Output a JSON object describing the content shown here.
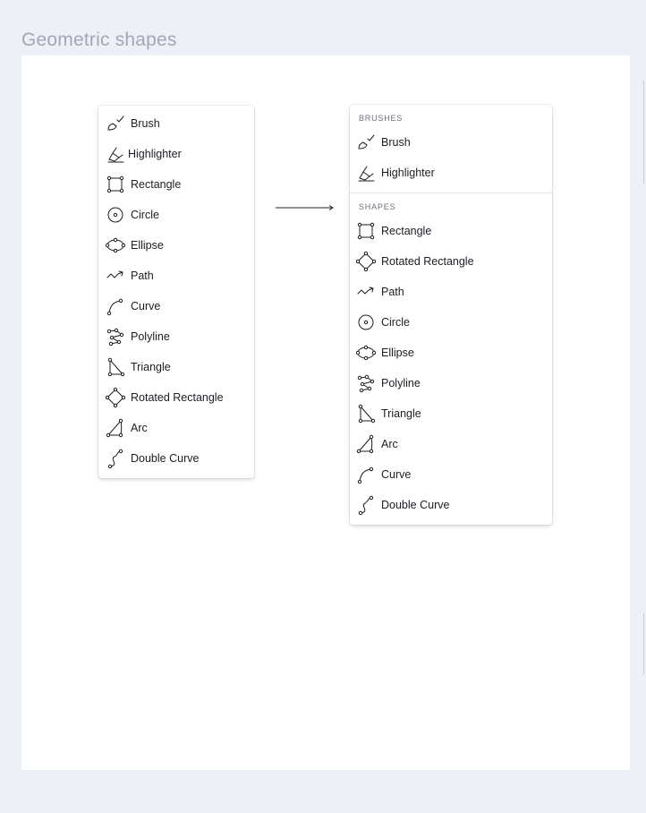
{
  "page": {
    "title": "Geometric shapes"
  },
  "left_menu": {
    "items": [
      {
        "label": "Brush",
        "icon": "brush-icon"
      },
      {
        "label": "Highlighter",
        "icon": "highlighter-icon"
      },
      {
        "label": "Rectangle",
        "icon": "rectangle-icon"
      },
      {
        "label": "Circle",
        "icon": "circle-icon"
      },
      {
        "label": "Ellipse",
        "icon": "ellipse-icon"
      },
      {
        "label": "Path",
        "icon": "path-icon"
      },
      {
        "label": "Curve",
        "icon": "curve-icon"
      },
      {
        "label": "Polyline",
        "icon": "polyline-icon"
      },
      {
        "label": "Triangle",
        "icon": "triangle-icon"
      },
      {
        "label": "Rotated Rectangle",
        "icon": "rotated-rectangle-icon"
      },
      {
        "label": "Arc",
        "icon": "arc-icon"
      },
      {
        "label": "Double Curve",
        "icon": "double-curve-icon"
      }
    ]
  },
  "right_menu": {
    "brushes": {
      "heading": "BRUSHES",
      "items": [
        {
          "label": "Brush",
          "icon": "brush-icon"
        },
        {
          "label": "Highlighter",
          "icon": "highlighter-icon"
        }
      ]
    },
    "shapes": {
      "heading": "SHAPES",
      "items": [
        {
          "label": "Rectangle",
          "icon": "rectangle-icon"
        },
        {
          "label": "Rotated Rectangle",
          "icon": "rotated-rectangle-icon"
        },
        {
          "label": "Path",
          "icon": "path-icon"
        },
        {
          "label": "Circle",
          "icon": "circle-icon"
        },
        {
          "label": "Ellipse",
          "icon": "ellipse-icon"
        },
        {
          "label": "Polyline",
          "icon": "polyline-icon"
        },
        {
          "label": "Triangle",
          "icon": "triangle-icon"
        },
        {
          "label": "Arc",
          "icon": "arc-icon"
        },
        {
          "label": "Curve",
          "icon": "curve-icon"
        },
        {
          "label": "Double Curve",
          "icon": "double-curve-icon"
        }
      ]
    }
  },
  "colors": {
    "background": "#eef0f8",
    "canvas": "#ffffff",
    "title": "#a3a7b3",
    "icon_stroke": "#1b1d22"
  }
}
